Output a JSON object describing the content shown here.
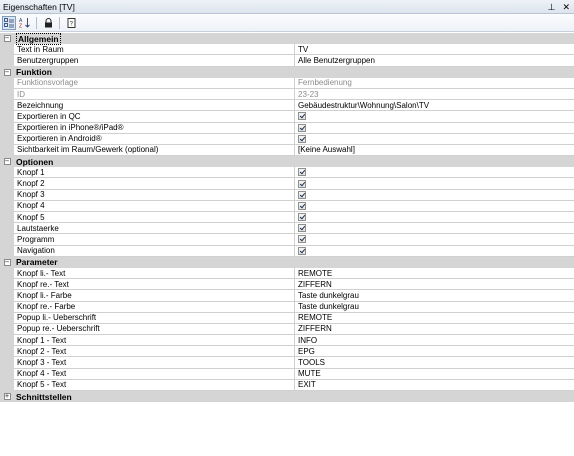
{
  "window": {
    "title": "Eigenschaften [TV]",
    "pin_glyph": "⊥",
    "close_glyph": "✕"
  },
  "toolbar": {
    "buttons": [
      {
        "icon": "categorized-icon",
        "glyph": "⊞",
        "active": true
      },
      {
        "icon": "sort-alphabetical-icon",
        "glyph": "A↓",
        "active": false
      },
      {
        "icon": "lock-icon",
        "glyph": "🔒",
        "active": false
      },
      {
        "icon": "property-pages-icon",
        "glyph": "?",
        "active": false
      }
    ]
  },
  "categories": [
    {
      "label": "Allgemein",
      "expanded": true,
      "rows": [
        {
          "name": "Text in Raum",
          "value": "TV"
        },
        {
          "name": "Benutzergruppen",
          "value": "Alle Benutzergruppen"
        }
      ]
    },
    {
      "label": "Funktion",
      "expanded": true,
      "rows": [
        {
          "name": "Funktionsvorlage",
          "value": "Fernbedienung",
          "disabled": true
        },
        {
          "name": "ID",
          "value": "23-23",
          "disabled": true
        },
        {
          "name": "Bezeichnung",
          "value": "Gebäudestruktur\\Wohnung\\Salon\\TV"
        },
        {
          "name": "Exportieren in QC",
          "checked": true
        },
        {
          "name": "Exportieren in iPhone®/iPad®",
          "checked": true
        },
        {
          "name": "Exportieren in Android®",
          "checked": true
        },
        {
          "name": "Sichtbarkeit im Raum/Gewerk (optional)",
          "value": "[Keine Auswahl]"
        }
      ]
    },
    {
      "label": "Optionen",
      "expanded": true,
      "rows": [
        {
          "name": "Knopf 1",
          "checked": true
        },
        {
          "name": "Knopf 2",
          "checked": true
        },
        {
          "name": "Knopf 3",
          "checked": true
        },
        {
          "name": "Knopf 4",
          "checked": true
        },
        {
          "name": "Knopf 5",
          "checked": true
        },
        {
          "name": "Lautstaerke",
          "checked": true
        },
        {
          "name": "Programm",
          "checked": true
        },
        {
          "name": "Navigation",
          "checked": true
        }
      ]
    },
    {
      "label": "Parameter",
      "expanded": true,
      "rows": [
        {
          "name": "Knopf li.- Text",
          "value": "REMOTE"
        },
        {
          "name": "Knopf re.- Text",
          "value": "ZIFFERN"
        },
        {
          "name": "Knopf li.- Farbe",
          "value": "Taste dunkelgrau"
        },
        {
          "name": "Knopf re.- Farbe",
          "value": "Taste dunkelgrau"
        },
        {
          "name": "Popup li.- Ueberschrift",
          "value": "REMOTE"
        },
        {
          "name": "Popup re.- Ueberschrift",
          "value": "ZIFFERN"
        },
        {
          "name": "Knopf 1 - Text",
          "value": "INFO"
        },
        {
          "name": "Knopf 2 - Text",
          "value": "EPG"
        },
        {
          "name": "Knopf 3 - Text",
          "value": "TOOLS"
        },
        {
          "name": "Knopf 4 - Text",
          "value": "MUTE"
        },
        {
          "name": "Knopf 5 - Text",
          "value": "EXIT"
        }
      ]
    },
    {
      "label": "Schnittstellen",
      "expanded": false,
      "rows": []
    }
  ]
}
